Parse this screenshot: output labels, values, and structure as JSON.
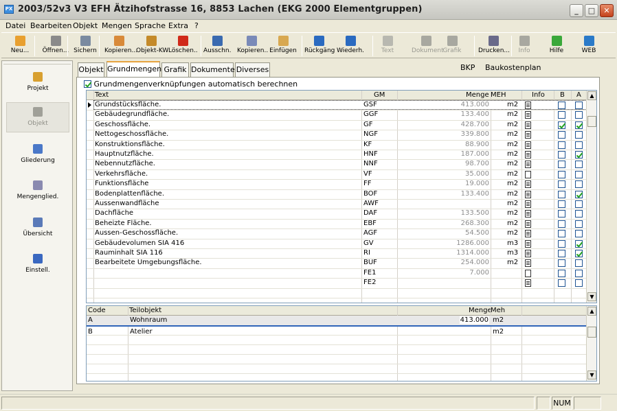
{
  "window": {
    "title": "2003/52v3 V3 EFH Ätzihofstrasse 16, 8853 Lachen (EKG 2000 Elementgruppen)",
    "icon_text": "PX"
  },
  "menu": [
    "Datei",
    "Bearbeiten",
    "Objekt",
    "Mengen",
    "Sprache",
    "Extra",
    "?"
  ],
  "toolbar": [
    {
      "label": "Neu...",
      "icon": "new-file-icon",
      "color": "#e8a030",
      "enabled": true
    },
    {
      "label": "Öffnen...",
      "icon": "open-folder-icon",
      "color": "#8a8a8a",
      "enabled": true
    },
    {
      "label": "Sichern",
      "icon": "save-icon",
      "color": "#7a8aa0",
      "enabled": true
    },
    {
      "label": "Kopieren...",
      "icon": "copy-icon",
      "color": "#d88a3a",
      "enabled": true
    },
    {
      "label": "Objekt-KW",
      "icon": "object-kw-icon",
      "color": "#c48a2a",
      "enabled": true
    },
    {
      "label": "Löschen..",
      "icon": "delete-icon",
      "color": "#d02a1a",
      "enabled": true
    },
    {
      "label": "Ausschn.",
      "icon": "cut-icon",
      "color": "#3a6ab0",
      "enabled": true
    },
    {
      "label": "Kopieren..",
      "icon": "copy-icon",
      "color": "#7a8ab8",
      "enabled": true
    },
    {
      "label": "Einfügen",
      "icon": "paste-icon",
      "color": "#d8a850",
      "enabled": true
    },
    {
      "label": "Rückgäng",
      "icon": "undo-icon",
      "color": "#2a6ac0",
      "enabled": true
    },
    {
      "label": "Wiederh.",
      "icon": "redo-icon",
      "color": "#2a6ac0",
      "enabled": true
    },
    {
      "label": "Text",
      "icon": "text-icon",
      "color": "#b8b8b0",
      "enabled": false
    },
    {
      "label": "Dokument",
      "icon": "document-icon",
      "color": "#a8a8a0",
      "enabled": false
    },
    {
      "label": "Grafik",
      "icon": "graphic-icon",
      "color": "#a8a8a0",
      "enabled": false
    },
    {
      "label": "Drucken...",
      "icon": "printer-icon",
      "color": "#6a6a8a",
      "enabled": true
    },
    {
      "label": "Info",
      "icon": "info-icon",
      "color": "#a8a8a0",
      "enabled": false
    },
    {
      "label": "Hilfe",
      "icon": "help-icon",
      "color": "#3aa83a",
      "enabled": true
    },
    {
      "label": "WEB",
      "icon": "globe-icon",
      "color": "#2a7ac8",
      "enabled": true
    }
  ],
  "nav": [
    {
      "label": "Projekt",
      "icon": "project-icon",
      "color": "#d8a030",
      "active": false
    },
    {
      "label": "Objekt",
      "icon": "object-icon",
      "color": "#a0a098",
      "active": true
    },
    {
      "label": "Gliederung",
      "icon": "structure-icon",
      "color": "#4a78c8",
      "active": false
    },
    {
      "label": "Mengenglied.",
      "icon": "quantity-structure-icon",
      "color": "#8a8ab0",
      "active": false
    },
    {
      "label": "Übersicht",
      "icon": "overview-icon",
      "color": "#5a7ab8",
      "active": false
    },
    {
      "label": "Einstell.",
      "icon": "settings-icon",
      "color": "#3a68c0",
      "active": false
    }
  ],
  "tabs": [
    {
      "label": "Objekt",
      "selected": false
    },
    {
      "label": "Grundmengen",
      "selected": true
    },
    {
      "label": "Grafik",
      "selected": false
    },
    {
      "label": "Dokumente",
      "selected": false
    },
    {
      "label": "Diverses",
      "selected": false
    }
  ],
  "header": {
    "bkp": "BKP",
    "bkp_value": "Baukostenplan"
  },
  "auto_check": {
    "label": "Grundmengenverknüpfungen automatisch berechnen",
    "checked": true
  },
  "grid1": {
    "columns": {
      "text": "Text",
      "gm": "GM",
      "menge": "Menge",
      "meh": "MEH",
      "info": "Info",
      "b": "B",
      "a": "A"
    },
    "rows": [
      {
        "text": "Grundstücksfläche.",
        "gm": "GSF",
        "menge": "413.000",
        "meh": "m2",
        "doc": true,
        "b": false,
        "a": false
      },
      {
        "text": "Gebäudegrundfläche.",
        "gm": "GGF",
        "menge": "133.400",
        "meh": "m2",
        "doc": true,
        "b": false,
        "a": false
      },
      {
        "text": "Geschossfläche.",
        "gm": "GF",
        "menge": "428.700",
        "meh": "m2",
        "doc": true,
        "b": true,
        "a": true
      },
      {
        "text": "Nettogeschossfläche.",
        "gm": "NGF",
        "menge": "339.800",
        "meh": "m2",
        "doc": true,
        "b": false,
        "a": false
      },
      {
        "text": "Konstruktionsfläche.",
        "gm": "KF",
        "menge": "88.900",
        "meh": "m2",
        "doc": true,
        "b": false,
        "a": false
      },
      {
        "text": "Hauptnutzfläche.",
        "gm": "HNF",
        "menge": "187.000",
        "meh": "m2",
        "doc": true,
        "b": false,
        "a": true
      },
      {
        "text": "Nebennutzfläche.",
        "gm": "NNF",
        "menge": "98.700",
        "meh": "m2",
        "doc": true,
        "b": false,
        "a": false
      },
      {
        "text": "Verkehrsfläche.",
        "gm": "VF",
        "menge": "35.000",
        "meh": "m2",
        "doc": false,
        "b": false,
        "a": false
      },
      {
        "text": "Funktionsfläche",
        "gm": "FF",
        "menge": "19.000",
        "meh": "m2",
        "doc": true,
        "b": false,
        "a": false
      },
      {
        "text": "Bodenplattenfläche.",
        "gm": "BOF",
        "menge": "133.400",
        "meh": "m2",
        "doc": true,
        "b": false,
        "a": true
      },
      {
        "text": "Aussenwandfläche",
        "gm": "AWF",
        "menge": "",
        "meh": "m2",
        "doc": true,
        "b": false,
        "a": false
      },
      {
        "text": "Dachfläche",
        "gm": "DAF",
        "menge": "133.500",
        "meh": "m2",
        "doc": true,
        "b": false,
        "a": false
      },
      {
        "text": "Beheizte Fläche.",
        "gm": "EBF",
        "menge": "268.300",
        "meh": "m2",
        "doc": true,
        "b": false,
        "a": false
      },
      {
        "text": "Aussen-Geschossfläche.",
        "gm": "AGF",
        "menge": "54.500",
        "meh": "m2",
        "doc": true,
        "b": false,
        "a": false
      },
      {
        "text": "Gebäudevolumen SIA 416",
        "gm": "GV",
        "menge": "1286.000",
        "meh": "m3",
        "doc": true,
        "b": false,
        "a": true
      },
      {
        "text": "Rauminhalt SIA 116",
        "gm": "RI",
        "menge": "1314.000",
        "meh": "m3",
        "doc": true,
        "b": false,
        "a": true
      },
      {
        "text": "Bearbeitete Umgebungsfläche.",
        "gm": "BUF",
        "menge": "254.000",
        "meh": "m2",
        "doc": true,
        "b": false,
        "a": false
      },
      {
        "text": "",
        "gm": "FE1",
        "menge": "7.000",
        "meh": "",
        "doc": false,
        "b": false,
        "a": false
      },
      {
        "text": "",
        "gm": "FE2",
        "menge": "",
        "meh": "",
        "doc": true,
        "b": false,
        "a": false
      },
      {
        "text": "",
        "gm": "",
        "menge": "",
        "meh": "",
        "doc": null,
        "b": null,
        "a": null
      }
    ]
  },
  "grid2": {
    "columns": {
      "code": "Code",
      "teilobjekt": "Teilobjekt",
      "menge": "Menge",
      "meh": "Meh"
    },
    "rows": [
      {
        "code": "A",
        "teilobjekt": "Wohnraum",
        "menge": "413.000",
        "meh": "m2"
      },
      {
        "code": "B",
        "teilobjekt": "Atelier",
        "menge": "",
        "meh": "m2"
      }
    ]
  },
  "status": {
    "num": "NUM"
  }
}
